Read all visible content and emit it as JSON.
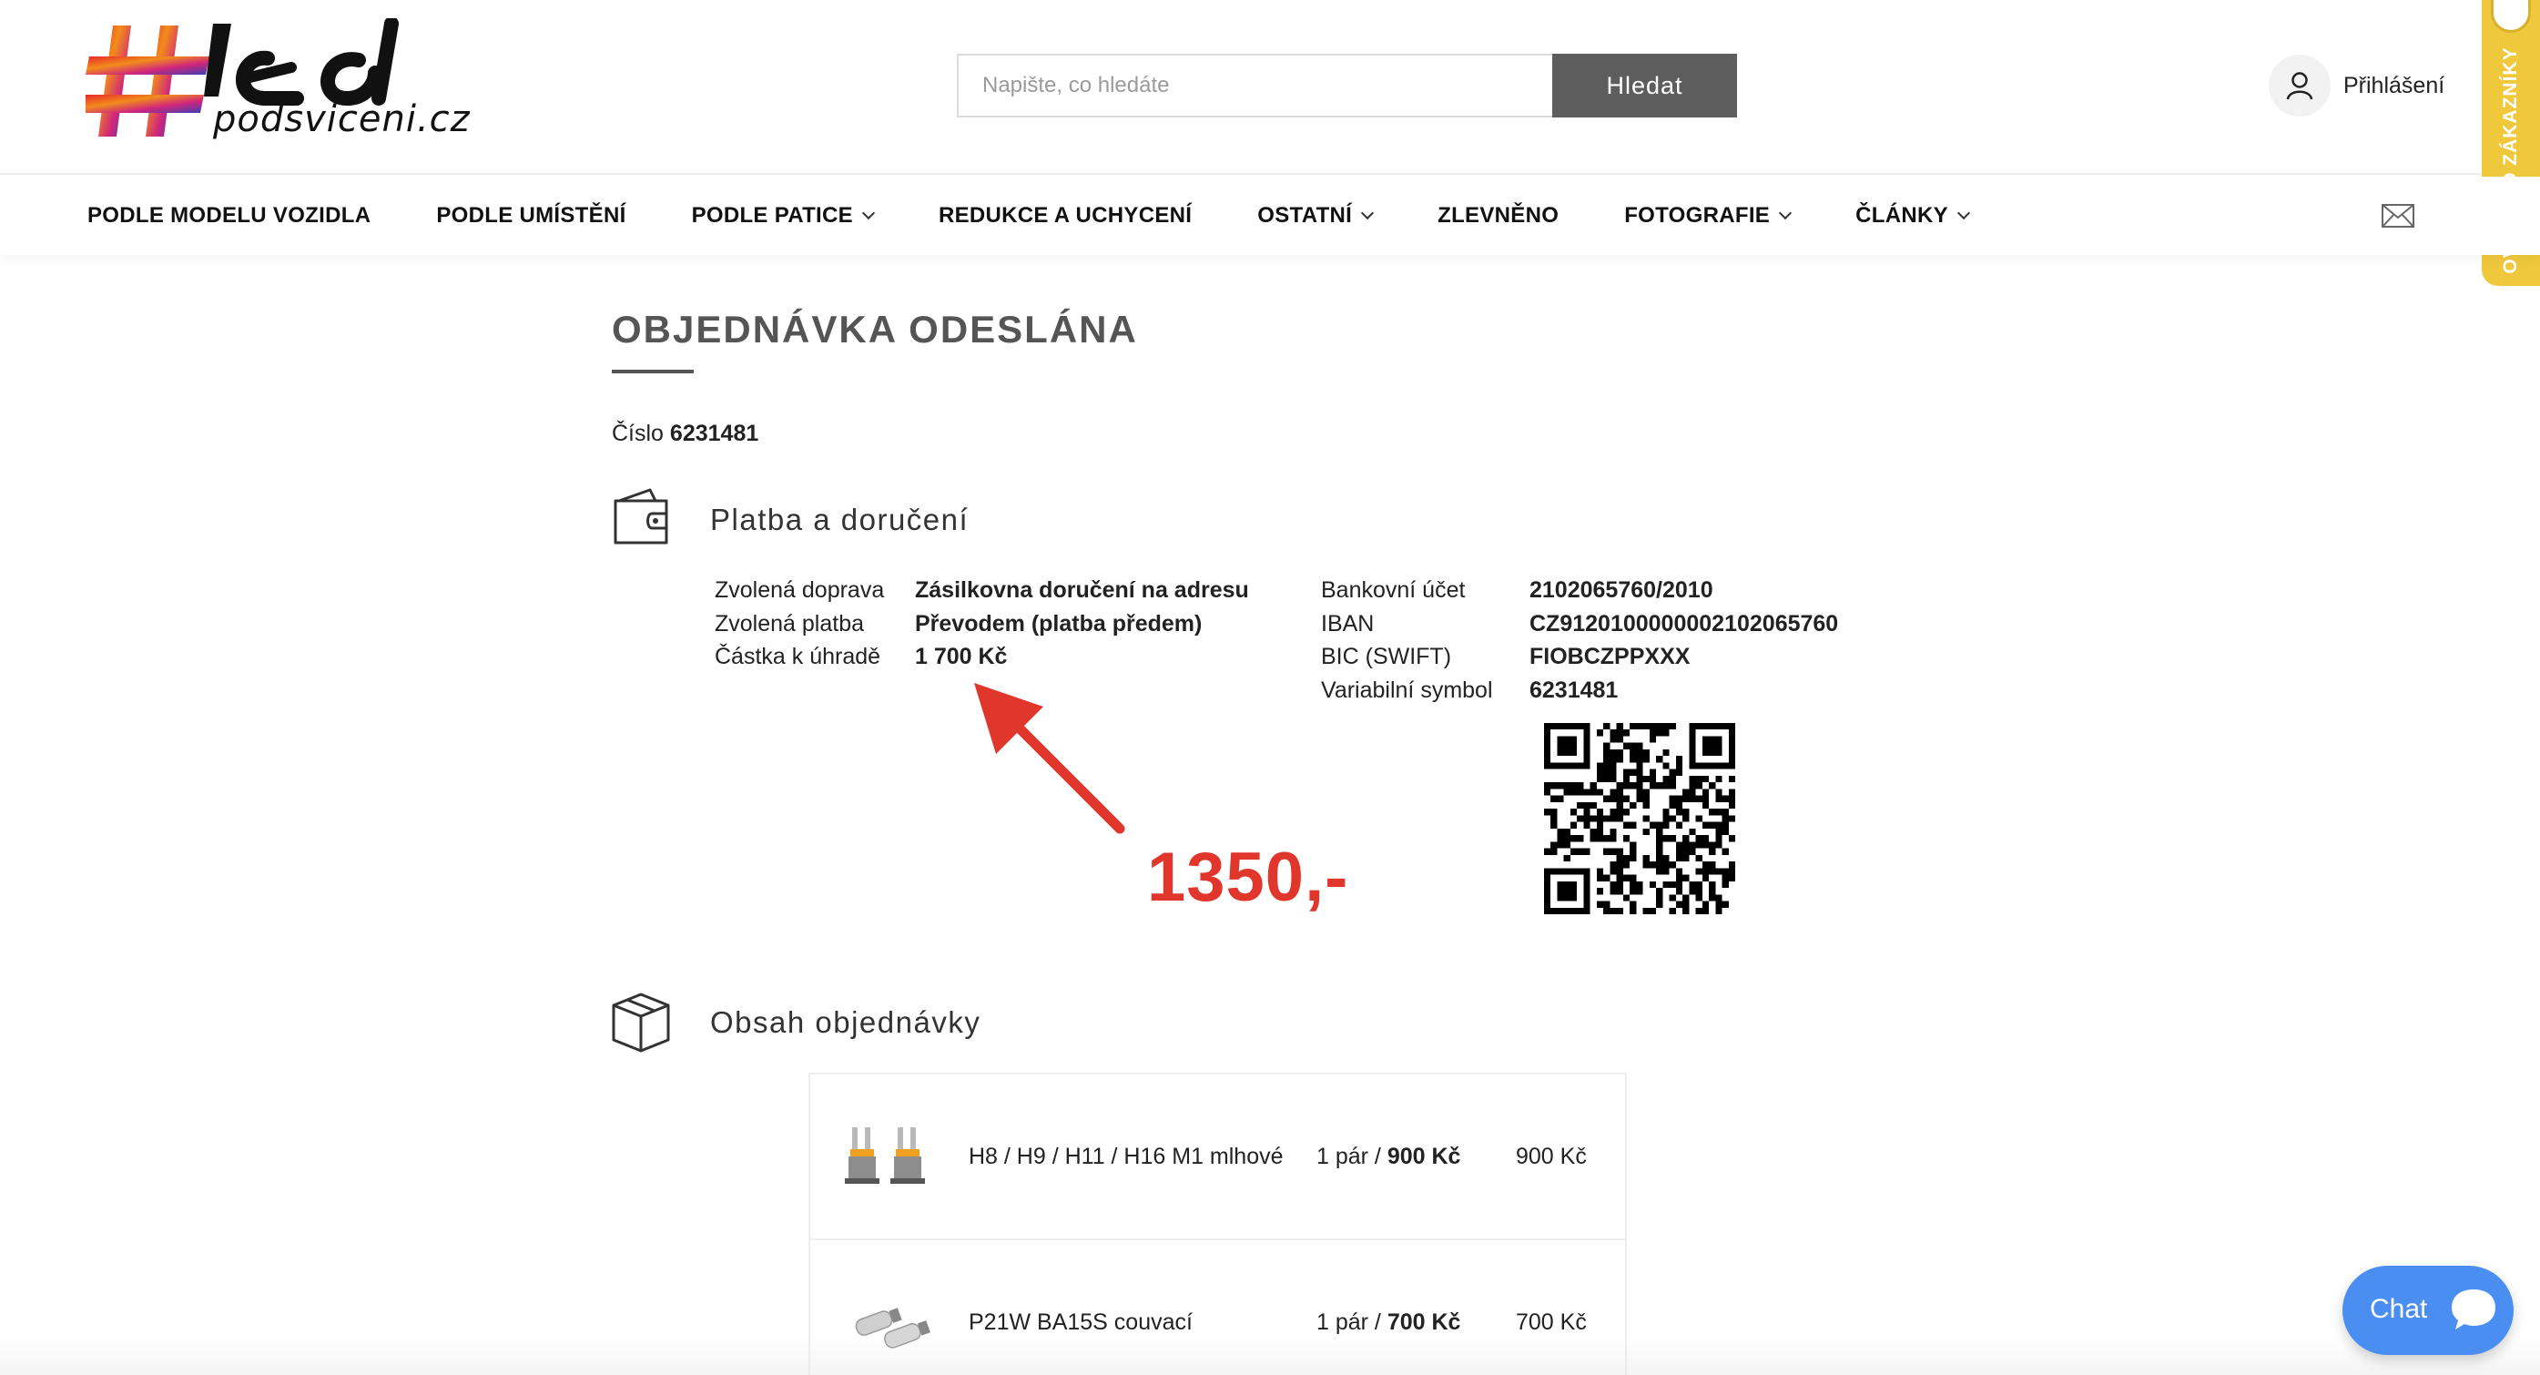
{
  "header": {
    "logo_text": "#led",
    "logo_domain": "podsviceni.cz",
    "search_placeholder": "Napište, co hledáte",
    "search_button": "Hledat",
    "login_label": "Přihlášení",
    "verified_badge": "OVĚŘENO ZÁKAZNÍKY"
  },
  "nav": {
    "items": [
      {
        "label": "PODLE MODELU VOZIDLA",
        "dropdown": false
      },
      {
        "label": "PODLE UMÍSTĚNÍ",
        "dropdown": false
      },
      {
        "label": "PODLE PATICE",
        "dropdown": true
      },
      {
        "label": "REDUKCE A UCHYCENÍ",
        "dropdown": false
      },
      {
        "label": "OSTATNÍ",
        "dropdown": true
      },
      {
        "label": "ZLEVNĚNO",
        "dropdown": false
      },
      {
        "label": "FOTOGRAFIE",
        "dropdown": true
      },
      {
        "label": "ČLÁNKY",
        "dropdown": true
      }
    ],
    "mail_icon": "mail-icon"
  },
  "page": {
    "title": "OBJEDNÁVKA ODESLÁNA",
    "order_label": "Číslo",
    "order_number": "6231481"
  },
  "payment": {
    "section_title": "Platba a doručení",
    "shipping_label": "Zvolená doprava",
    "shipping_value": "Zásilkovna doručení na adresu",
    "method_label": "Zvolená platba",
    "method_value": "Převodem (platba předem)",
    "amount_label": "Částka k úhradě",
    "amount_value": "1 700 Kč",
    "bank_account_label": "Bankovní účet",
    "bank_account_value": "2102065760/2010",
    "iban_label": "IBAN",
    "iban_value": "CZ9120100000002102065760",
    "bic_label": "BIC (SWIFT)",
    "bic_value": "FIOBCZPPXXX",
    "vs_label": "Variabilní symbol",
    "vs_value": "6231481"
  },
  "annotation": {
    "text": "1350,-",
    "color": "#e0362b"
  },
  "order_contents": {
    "section_title": "Obsah objednávky",
    "items": [
      {
        "name": "H8 / H9 / H11 / H16 M1 mlhové",
        "qty_text": "1 pár / ",
        "unit_price": "900 Kč",
        "total": "900 Kč"
      },
      {
        "name": "P21W BA15S couvací",
        "qty_text": "1 pár / ",
        "unit_price": "700 Kč",
        "total": "700 Kč"
      }
    ]
  },
  "chat": {
    "label": "Chat",
    "color": "#4b8ef1"
  }
}
